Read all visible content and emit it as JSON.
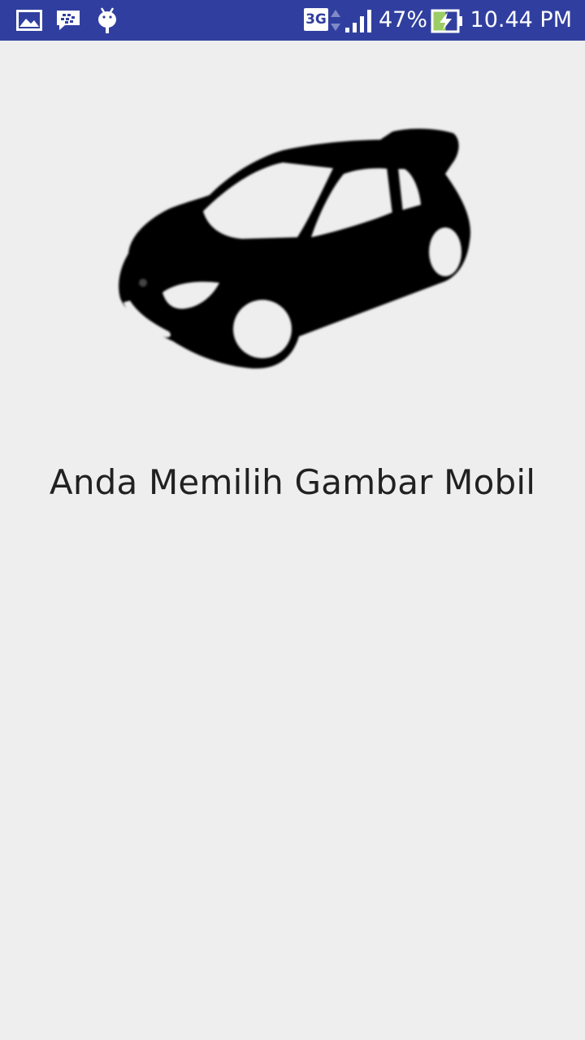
{
  "status_bar": {
    "background_color": "#303f9f",
    "left_icons": [
      "gallery-icon",
      "bbm-chat-icon",
      "android-debug-icon"
    ],
    "network_type": "3G",
    "battery_percent": "47%",
    "battery_level": 0.47,
    "battery_charging": true,
    "time": "10.44 PM"
  },
  "main": {
    "image_icon": "car-silhouette-icon",
    "message": "Anda Memilih Gambar Mobil",
    "background_color": "#eeeeee"
  }
}
